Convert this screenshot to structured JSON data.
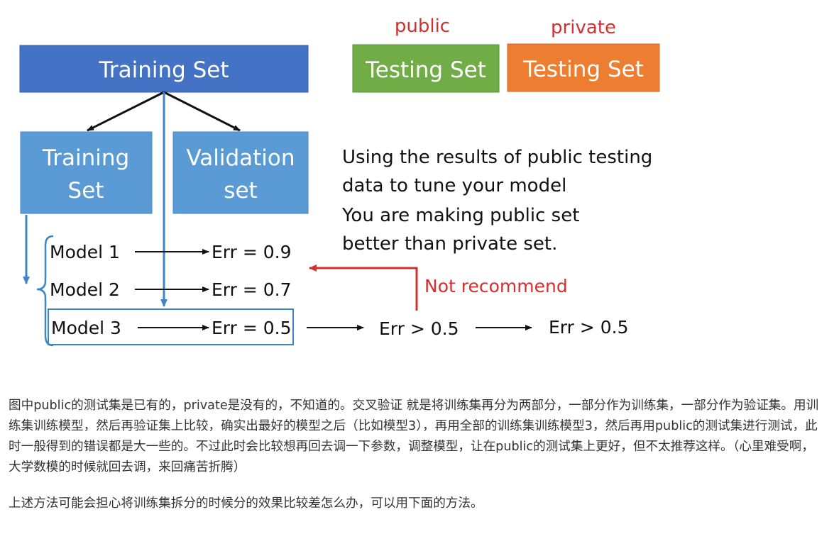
{
  "diagram": {
    "labels": {
      "public": "public",
      "private": "private"
    },
    "boxes": {
      "training_set": "Training Set",
      "public_testing_set": "Testing Set",
      "private_testing_set": "Testing Set",
      "sub_training_line1": "Training",
      "sub_training_line2": "Set",
      "validation_line1": "Validation",
      "validation_line2": "set"
    },
    "models": [
      "Model 1",
      "Model 2",
      "Model 3"
    ],
    "errors": [
      "Err = 0.9",
      "Err = 0.7",
      "Err = 0.5"
    ],
    "later_errors": [
      "Err > 0.5",
      "Err > 0.5"
    ],
    "note_lines": [
      "Using the results of public testing",
      "data to tune your model",
      "You are making public set",
      "better than private set."
    ],
    "not_recommend": "Not recommend",
    "colors": {
      "training_set": "#4472c4",
      "public_testing": "#70ad47",
      "private_testing": "#ed7d31",
      "sub_boxes": "#5b9bd5",
      "arrow_blue": "#3d85c6",
      "red": "#d32f2f"
    }
  },
  "caption": {
    "paragraph1": "图中public的测试集是已有的，private是没有的，不知道的。交叉验证 就是将训练集再分为两部分，一部分作为训练集，一部分作为验证集。用训练集训练模型，然后再验证集上比较，确实出最好的模型之后（比如模型3），再用全部的训练集训练模型3，然后再用public的测试集进行测试，此时一般得到的错误都是大一些的。不过此时会比较想再回去调一下参数，调整模型，让在public的测试集上更好，但不太推荐这样。（心里难受啊，大学数模的时候就回去调，来回痛苦折腾）",
    "paragraph2": "上述方法可能会担心将训练集拆分的时候分的效果比较差怎么办，可以用下面的方法。"
  }
}
